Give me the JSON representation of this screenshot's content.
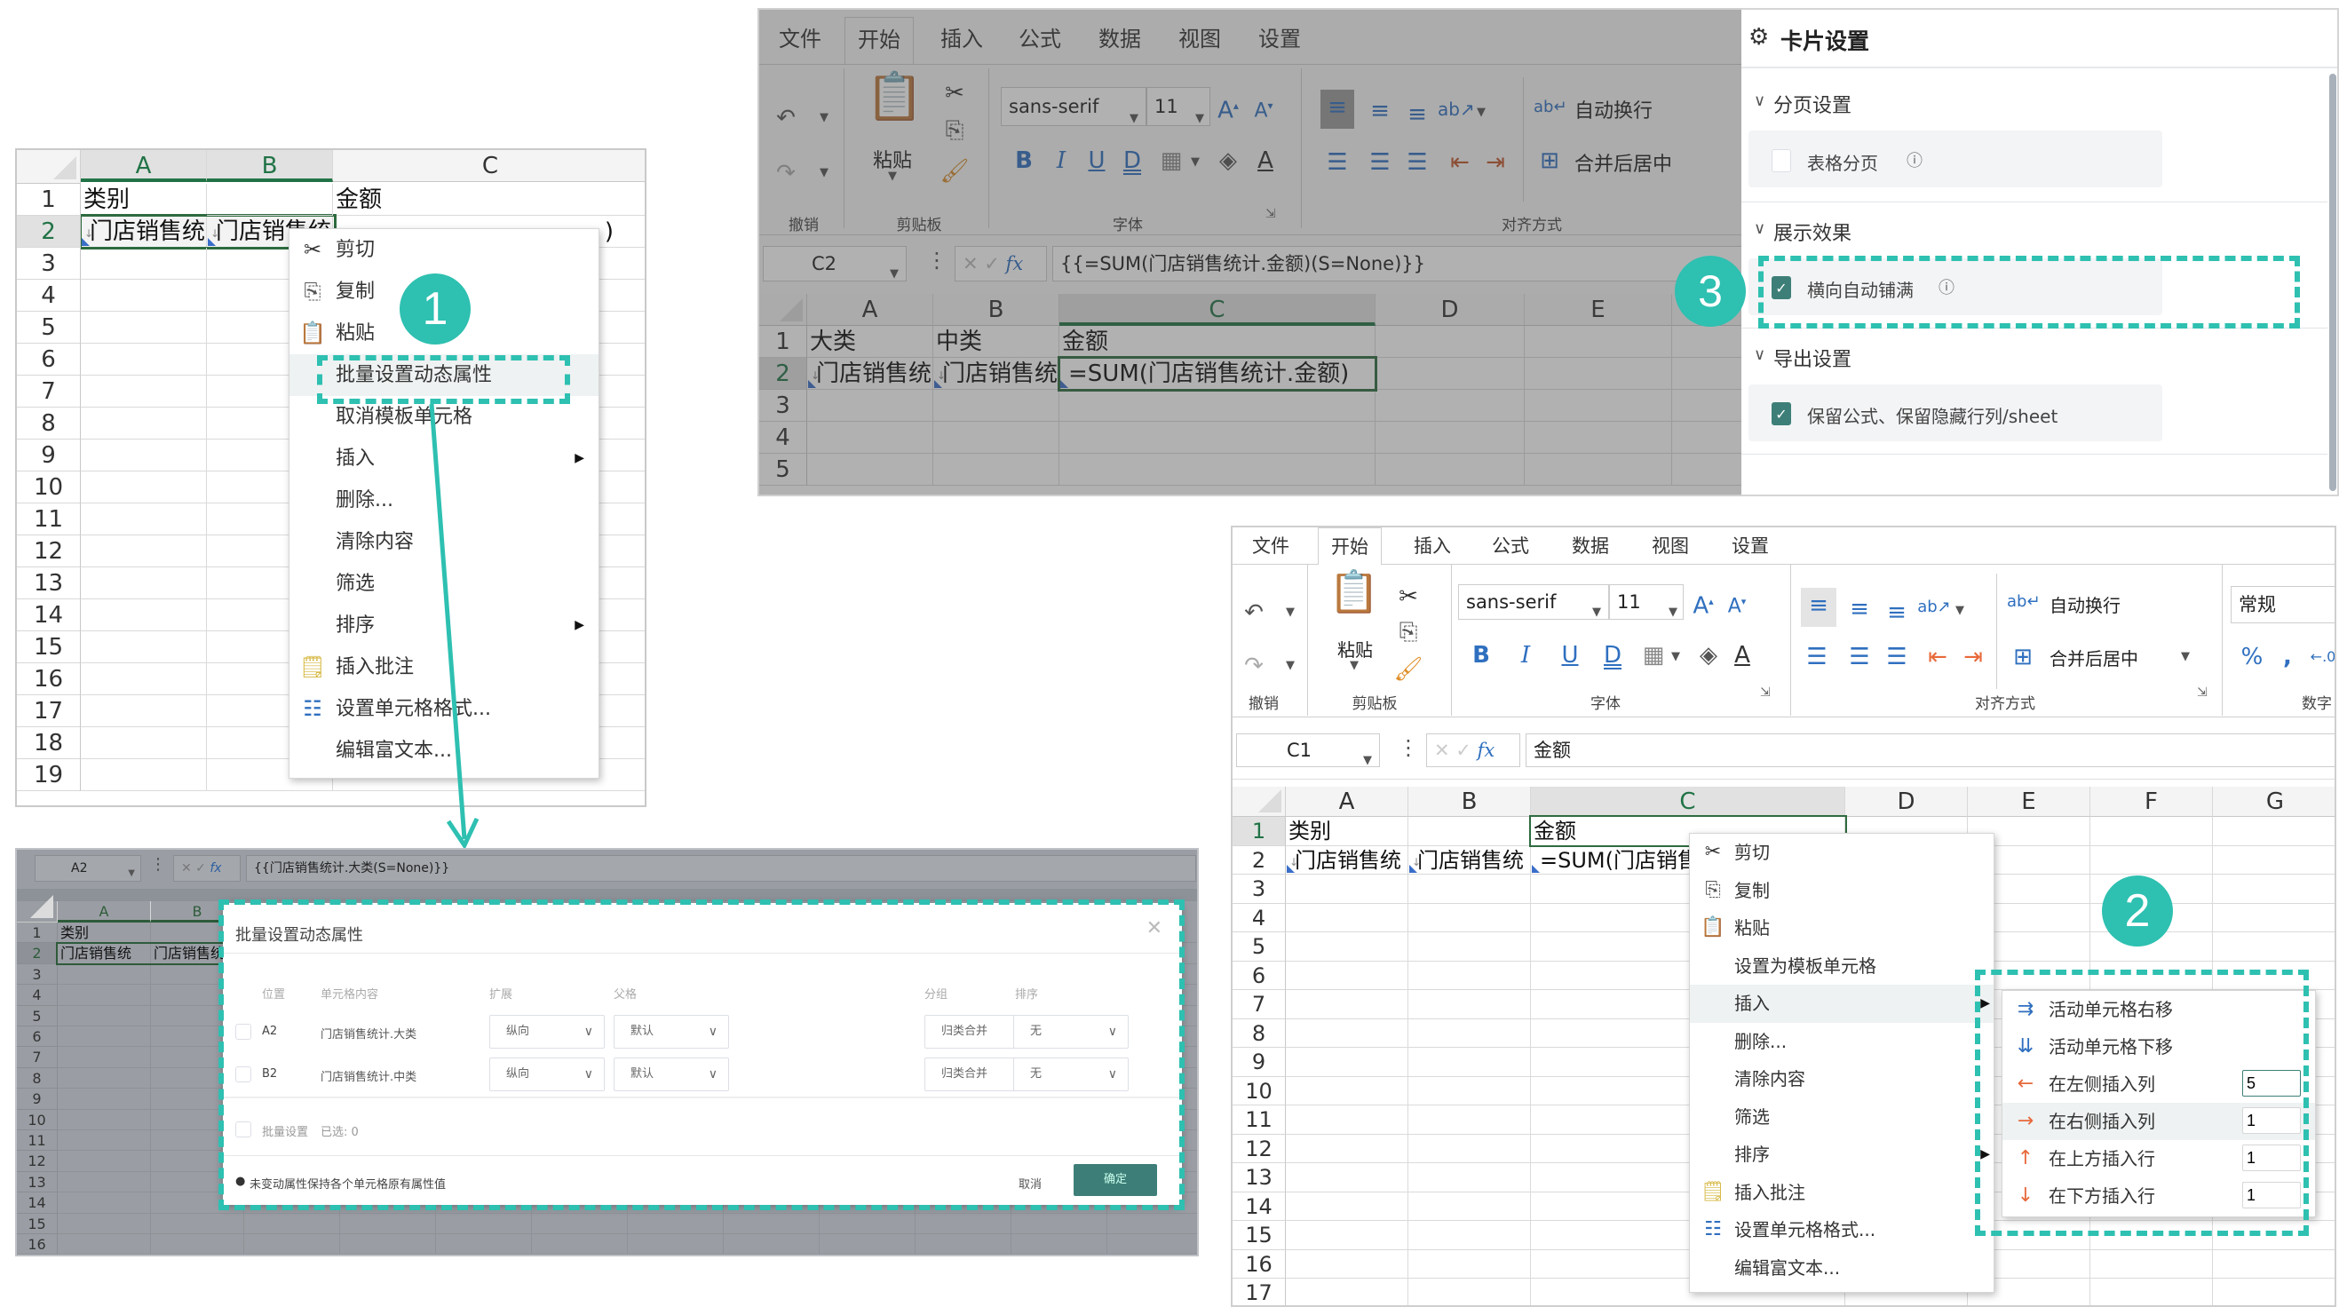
{
  "panel1": {
    "columns": [
      "A",
      "B",
      "C"
    ],
    "rows": [
      "1",
      "2",
      "3",
      "4",
      "5",
      "6",
      "7",
      "8",
      "9",
      "10",
      "11",
      "12",
      "13",
      "14",
      "15",
      "16",
      "17",
      "18",
      "19"
    ],
    "cells": {
      "A1": "类别",
      "C1": "金额",
      "A2": "门店销售统",
      "B2": "门店销售统",
      "C2_tail": ")"
    },
    "context_menu": [
      {
        "label": "剪切",
        "icon": "scissors-icon"
      },
      {
        "label": "复制",
        "icon": "copy-icon"
      },
      {
        "label": "粘贴",
        "icon": "paste-icon"
      },
      {
        "label": "批量设置动态属性",
        "icon": ""
      },
      {
        "label": "取消模板单元格",
        "icon": ""
      },
      {
        "label": "插入",
        "icon": "",
        "submenu": true
      },
      {
        "label": "删除...",
        "icon": ""
      },
      {
        "label": "清除内容",
        "icon": ""
      },
      {
        "label": "筛选",
        "icon": ""
      },
      {
        "label": "排序",
        "icon": "",
        "submenu": true
      },
      {
        "label": "插入批注",
        "icon": "comment-icon"
      },
      {
        "label": "设置单元格格式...",
        "icon": "format-cells-icon"
      },
      {
        "label": "编辑富文本...",
        "icon": ""
      }
    ],
    "badge": "1"
  },
  "panel2": {
    "tabs": [
      "文件",
      "开始",
      "插入",
      "公式",
      "数据",
      "视图",
      "设置"
    ],
    "active_tab": "开始",
    "groups": {
      "undo": "撤销",
      "clipboard": "剪贴板",
      "font": "字体",
      "align": "对齐方式"
    },
    "paste_label": "粘贴",
    "font_name": "sans-serif",
    "font_size": "11",
    "wrap_label": "自动换行",
    "merge_label": "合并后居中",
    "name_box": "C2",
    "formula": "{{=SUM(门店销售统计.金额)(S=None)}}",
    "columns": [
      "A",
      "B",
      "C",
      "D",
      "E"
    ],
    "rows": [
      "1",
      "2",
      "3",
      "4",
      "5"
    ],
    "cells": {
      "A1": "大类",
      "B1": "中类",
      "C1": "金额",
      "A2": "门店销售统",
      "B2": "门店销售统",
      "C2": "=SUM(门店销售统计.金额)"
    }
  },
  "settings": {
    "title": "卡片设置",
    "sections": [
      {
        "title": "分页设置",
        "option": "表格分页",
        "checked": false,
        "hint_icon": "help-circle-icon"
      },
      {
        "title": "展示效果",
        "option": "横向自动铺满",
        "checked": true,
        "hint_icon": "info-circle-icon"
      },
      {
        "title": "导出设置",
        "option": "保留公式、保留隐藏行列/sheet",
        "checked": true
      }
    ],
    "badge": "3"
  },
  "panel4": {
    "name_box": "A2",
    "formula": "{{门店销售统计.大类(S=None)}}",
    "columns": [
      "A",
      "B"
    ],
    "rows": [
      "1",
      "2",
      "3",
      "4",
      "5",
      "6",
      "7",
      "8",
      "9",
      "10",
      "11",
      "12",
      "13",
      "14",
      "15",
      "16"
    ],
    "cells": {
      "A1": "类别",
      "A2": "门店销售统",
      "B2": "门店销售统"
    },
    "dialog": {
      "title": "批量设置动态属性",
      "headers": {
        "pos": "位置",
        "content": "单元格内容",
        "expand": "扩展",
        "parent": "父格",
        "group": "分组",
        "sort": "排序"
      },
      "rows": [
        {
          "pos": "A2",
          "content": "门店销售统计.大类",
          "expand": "纵向",
          "parent": "默认",
          "group": "归类合并",
          "sort": "无"
        },
        {
          "pos": "B2",
          "content": "门店销售统计.中类",
          "expand": "纵向",
          "parent": "默认",
          "group": "归类合并",
          "sort": "无"
        }
      ],
      "batch_label": "批量设置",
      "selected_label": "已选: 0",
      "note": "未变动属性保持各个单元格原有属性值",
      "cancel": "取消",
      "ok": "确定"
    }
  },
  "panel5": {
    "tabs": [
      "文件",
      "开始",
      "插入",
      "公式",
      "数据",
      "视图",
      "设置"
    ],
    "active_tab": "开始",
    "groups": {
      "undo": "撤销",
      "clipboard": "剪贴板",
      "font": "字体",
      "align": "对齐方式",
      "number": "数字"
    },
    "paste_label": "粘贴",
    "font_name": "sans-serif",
    "font_size": "11",
    "wrap_label": "自动换行",
    "merge_label": "合并后居中",
    "number_format": "常规",
    "name_box": "C1",
    "formula": "金额",
    "columns": [
      "A",
      "B",
      "C",
      "D",
      "E",
      "F",
      "G"
    ],
    "rows": [
      "1",
      "2",
      "3",
      "4",
      "5",
      "6",
      "7",
      "8",
      "9",
      "10",
      "11",
      "12",
      "13",
      "14",
      "15",
      "16",
      "17"
    ],
    "cells": {
      "A1": "类别",
      "C1": "金额",
      "A2": "门店销售统",
      "B2": "门店销售统",
      "C2": "=SUM(门店销售统"
    },
    "context_menu": [
      {
        "label": "剪切",
        "icon": "scissors-icon"
      },
      {
        "label": "复制",
        "icon": "copy-icon"
      },
      {
        "label": "粘贴",
        "icon": "paste-icon"
      },
      {
        "label": "设置为模板单元格",
        "icon": ""
      },
      {
        "label": "插入",
        "icon": "",
        "submenu": true
      },
      {
        "label": "删除...",
        "icon": ""
      },
      {
        "label": "清除内容",
        "icon": ""
      },
      {
        "label": "筛选",
        "icon": ""
      },
      {
        "label": "排序",
        "icon": "",
        "submenu": true
      },
      {
        "label": "插入批注",
        "icon": "comment-icon"
      },
      {
        "label": "设置单元格格式...",
        "icon": "format-cells-icon"
      },
      {
        "label": "编辑富文本...",
        "icon": ""
      }
    ],
    "submenu": [
      {
        "label": "活动单元格右移",
        "icon": "shift-right-icon"
      },
      {
        "label": "活动单元格下移",
        "icon": "shift-down-icon"
      },
      {
        "label": "在左侧插入列",
        "icon": "arrow-left-icon",
        "value": "5"
      },
      {
        "label": "在右侧插入列",
        "icon": "arrow-right-icon",
        "value": "1"
      },
      {
        "label": "在上方插入行",
        "icon": "arrow-up-icon",
        "value": "1"
      },
      {
        "label": "在下方插入行",
        "icon": "arrow-down-icon",
        "value": "1"
      }
    ],
    "badge": "2"
  },
  "colors": {
    "accent": "#2ec0b1",
    "checkbox": "#3d7f78",
    "selection": "#217346",
    "arrow_icon": "#e8693b"
  }
}
